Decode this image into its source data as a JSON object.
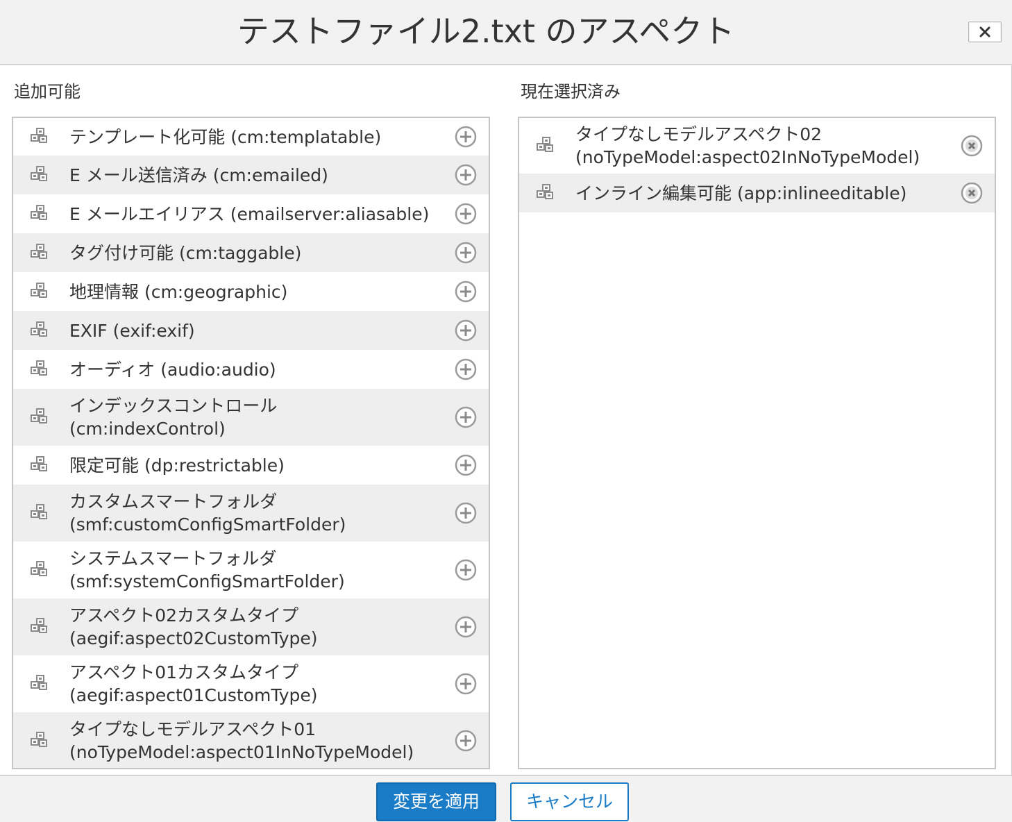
{
  "dialog": {
    "title": "テストファイル2.txt のアスペクト",
    "close_label": "✕"
  },
  "available": {
    "header": "追加可能",
    "items": [
      {
        "lines": [
          "テンプレート化可能 (cm:templatable)"
        ]
      },
      {
        "lines": [
          "E メール送信済み (cm:emailed)"
        ]
      },
      {
        "lines": [
          "E メールエイリアス (emailserver:aliasable)"
        ]
      },
      {
        "lines": [
          "タグ付け可能 (cm:taggable)"
        ]
      },
      {
        "lines": [
          "地理情報 (cm:geographic)"
        ]
      },
      {
        "lines": [
          "EXIF (exif:exif)"
        ]
      },
      {
        "lines": [
          "オーディオ (audio:audio)"
        ]
      },
      {
        "lines": [
          "インデックスコントロール",
          "(cm:indexControl)"
        ]
      },
      {
        "lines": [
          "限定可能 (dp:restrictable)"
        ]
      },
      {
        "lines": [
          "カスタムスマートフォルダ",
          "(smf:customConfigSmartFolder)"
        ]
      },
      {
        "lines": [
          "システムスマートフォルダ",
          "(smf:systemConfigSmartFolder)"
        ]
      },
      {
        "lines": [
          "アスペクト02カスタムタイプ",
          "(aegif:aspect02CustomType)"
        ]
      },
      {
        "lines": [
          "アスペクト01カスタムタイプ",
          "(aegif:aspect01CustomType)"
        ]
      },
      {
        "lines": [
          "タイプなしモデルアスペクト01",
          "(noTypeModel:aspect01InNoTypeModel)"
        ]
      }
    ]
  },
  "selected": {
    "header": "現在選択済み",
    "items": [
      {
        "lines": [
          "タイプなしモデルアスペクト02",
          "(noTypeModel:aspect02InNoTypeModel)"
        ]
      },
      {
        "lines": [
          "インライン編集可能 (app:inlineeditable)"
        ]
      }
    ]
  },
  "footer": {
    "apply_label": "変更を適用",
    "cancel_label": "キャンセル"
  },
  "colors": {
    "primary": "#1a7cc6",
    "row_alt": "#eeeeee",
    "icon_gray": "#8a8a8a"
  },
  "icons": {
    "aspect": "aspect-cubes-icon",
    "add": "plus-circle-icon",
    "remove": "x-circle-icon",
    "close": "close-icon"
  }
}
